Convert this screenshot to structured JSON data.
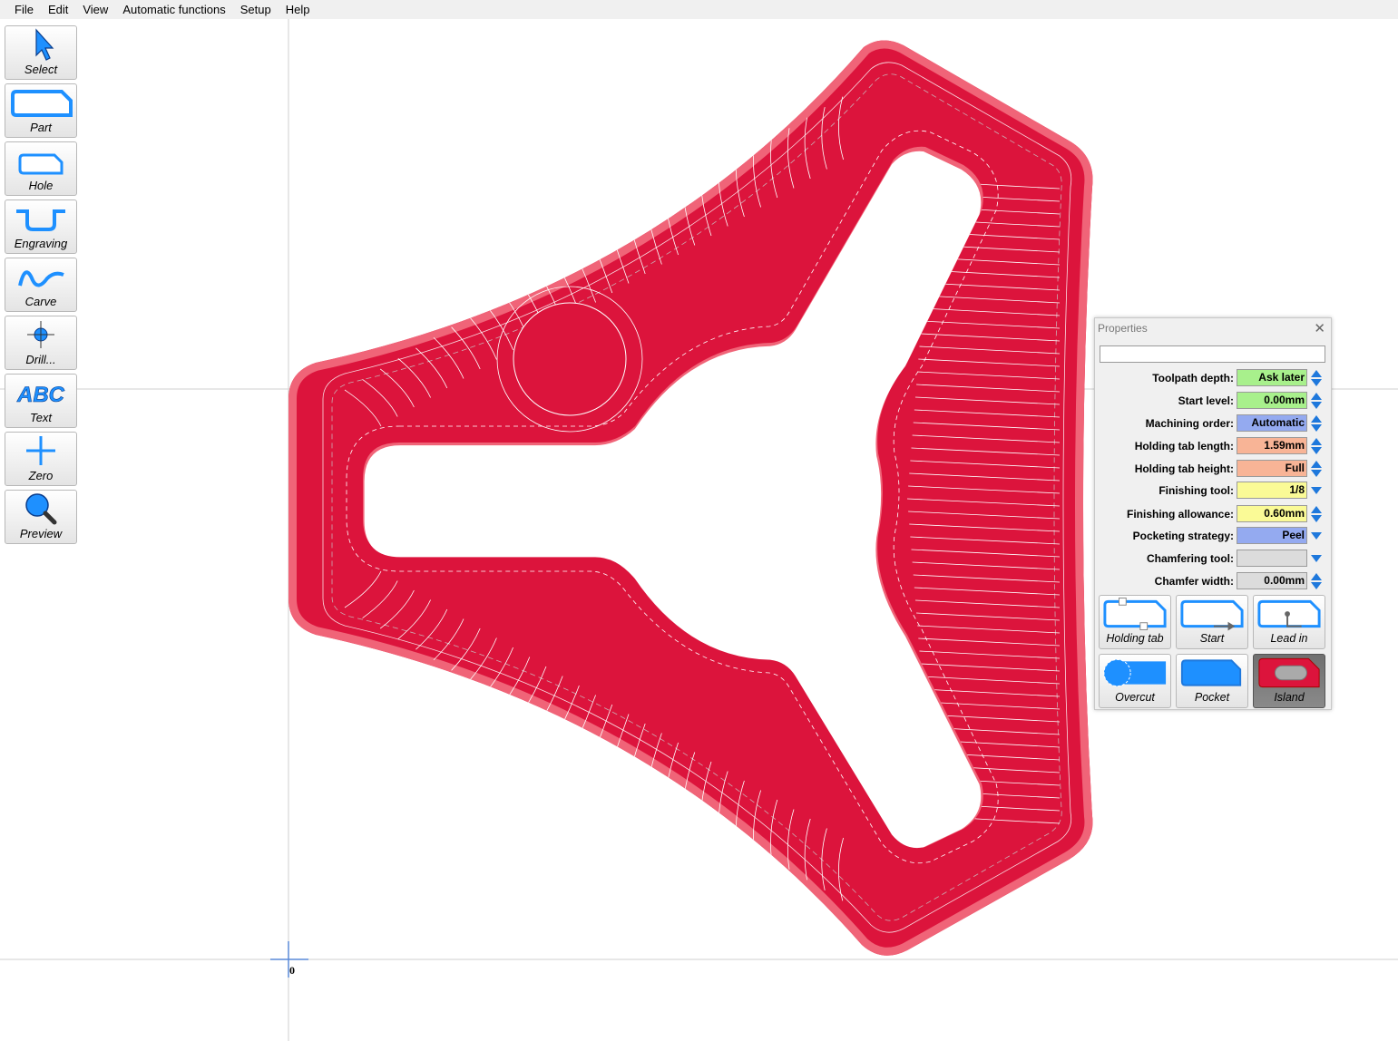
{
  "menu": [
    "File",
    "Edit",
    "View",
    "Automatic functions",
    "Setup",
    "Help"
  ],
  "toolbar": [
    {
      "label": "Select",
      "icon": "cursor-arrow-icon"
    },
    {
      "label": "Part",
      "icon": "part-outline-icon"
    },
    {
      "label": "Hole",
      "icon": "hole-outline-icon"
    },
    {
      "label": "Engraving",
      "icon": "engraving-groove-icon"
    },
    {
      "label": "Carve",
      "icon": "carve-wave-icon"
    },
    {
      "label": "Drill...",
      "icon": "drill-crosshair-icon"
    },
    {
      "label": "Text",
      "icon": "abc-text-icon",
      "glyph": "ABC"
    },
    {
      "label": "Zero",
      "icon": "zero-plus-icon"
    },
    {
      "label": "Preview",
      "icon": "magnifier-icon"
    }
  ],
  "canvas": {
    "origin_label": "0",
    "part_color": "#dc143c",
    "edge_color": "#f06478"
  },
  "properties": {
    "title": "Properties",
    "close": "✕",
    "name_value": "",
    "rows": [
      {
        "label": "Toolpath depth:",
        "value": "Ask later",
        "color": "#a8f08c",
        "control": "spin"
      },
      {
        "label": "Start level:",
        "value": "0.00mm",
        "color": "#a8f08c",
        "control": "spin"
      },
      {
        "label": "Machining order:",
        "value": "Automatic",
        "color": "#94aaf0",
        "control": "spin"
      },
      {
        "label": "Holding tab length:",
        "value": "1.59mm",
        "color": "#f8b496",
        "control": "spin"
      },
      {
        "label": "Holding tab height:",
        "value": "Full",
        "color": "#f8b496",
        "control": "spin"
      },
      {
        "label": "Finishing tool:",
        "value": "1/8",
        "color": "#fafa96",
        "control": "dropdown"
      },
      {
        "label": "Finishing allowance:",
        "value": "0.60mm",
        "color": "#fafa96",
        "control": "spin"
      },
      {
        "label": "Pocketing strategy:",
        "value": "Peel",
        "color": "#94aaf0",
        "control": "dropdown"
      },
      {
        "label": "Chamfering tool:",
        "value": "",
        "color": "#dcdcdc",
        "control": "dropdown"
      },
      {
        "label": "Chamfer width:",
        "value": "0.00mm",
        "color": "#dcdcdc",
        "control": "spin"
      }
    ],
    "buttons": [
      {
        "label": "Holding tab",
        "icon": "holding-tab-icon"
      },
      {
        "label": "Start",
        "icon": "start-point-icon"
      },
      {
        "label": "Lead in",
        "icon": "lead-in-icon"
      },
      {
        "label": "Overcut",
        "icon": "overcut-icon"
      },
      {
        "label": "Pocket",
        "icon": "pocket-icon"
      },
      {
        "label": "Island",
        "icon": "island-icon",
        "active": true
      }
    ]
  }
}
